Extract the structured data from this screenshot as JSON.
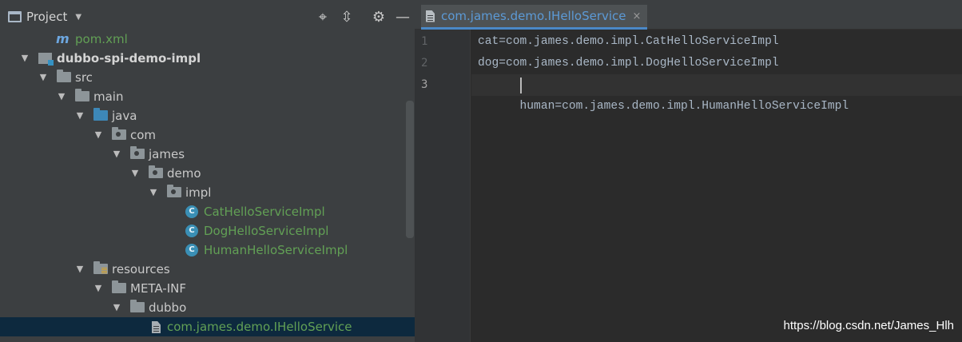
{
  "project_panel": {
    "title": "Project",
    "tools": [
      "locate-icon",
      "collapse-icon",
      "gear-icon",
      "minimize-icon"
    ]
  },
  "tree": [
    {
      "label": "pom.xml",
      "icon": "maven-icon",
      "style": "green",
      "depth": "file"
    },
    {
      "label": "dubbo-spi-demo-impl",
      "icon": "module-icon",
      "style": "bold"
    },
    {
      "label": "src",
      "icon": "folder-icon",
      "style": "plain"
    },
    {
      "label": "main",
      "icon": "folder-icon",
      "style": "plain"
    },
    {
      "label": "java",
      "icon": "source-folder-icon",
      "style": "plain"
    },
    {
      "label": "com",
      "icon": "package-icon",
      "style": "plain"
    },
    {
      "label": "james",
      "icon": "package-icon",
      "style": "plain"
    },
    {
      "label": "demo",
      "icon": "package-icon",
      "style": "plain"
    },
    {
      "label": "impl",
      "icon": "package-icon",
      "style": "plain"
    },
    {
      "label": "CatHelloServiceImpl",
      "icon": "class-icon",
      "style": "green"
    },
    {
      "label": "DogHelloServiceImpl",
      "icon": "class-icon",
      "style": "green"
    },
    {
      "label": "HumanHelloServiceImpl",
      "icon": "class-icon",
      "style": "green"
    },
    {
      "label": "resources",
      "icon": "resources-folder-icon",
      "style": "plain"
    },
    {
      "label": "META-INF",
      "icon": "folder-icon",
      "style": "plain"
    },
    {
      "label": "dubbo",
      "icon": "folder-icon",
      "style": "plain"
    },
    {
      "label": "com.james.demo.IHelloService",
      "icon": "file-icon",
      "style": "green",
      "selected": true
    }
  ],
  "editor": {
    "tab_label": "com.james.demo.IHelloService",
    "close_glyph": "×",
    "lines": [
      {
        "number": "1",
        "text": "cat=com.james.demo.impl.CatHelloServiceImpl"
      },
      {
        "number": "2",
        "text": "dog=com.james.demo.impl.DogHelloServiceImpl"
      },
      {
        "number": "3",
        "text": "human=com.james.demo.impl.HumanHelloServiceImpl"
      }
    ]
  },
  "watermark": "https://blog.csdn.net/James_Hlh",
  "colors": {
    "panel_bg": "#3c3f41",
    "editor_bg": "#2b2b2b",
    "selected_row": "#0d293e",
    "tree_green": "#62a055",
    "tab_text": "#5c9ad6",
    "code_text": "#a9b7c6",
    "class_icon": "#3a8fb5"
  }
}
